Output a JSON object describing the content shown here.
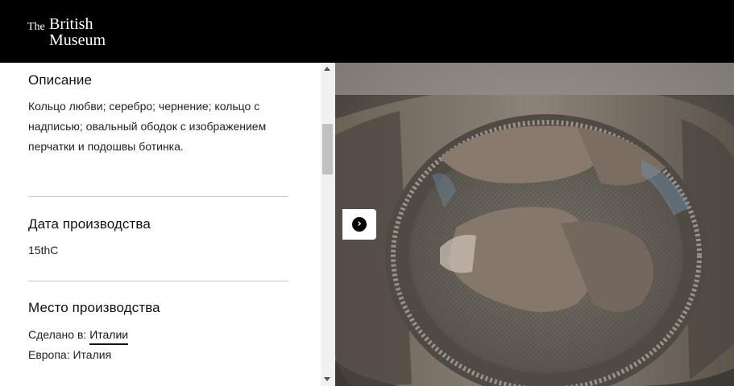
{
  "header": {
    "logo_the": "The",
    "logo_line1": "British",
    "logo_line2": "Museum"
  },
  "details": {
    "description": {
      "title": "Описание",
      "text": "Кольцо любви; серебро; чернение; кольцо с надписью; овальный ободок с изображением перчатки и подошвы ботинка."
    },
    "production_date": {
      "title": "Дата производства",
      "value": "15thC"
    },
    "production_place": {
      "title": "Место производства",
      "made_in_label": "Сделано в:",
      "made_in_link": "Италии",
      "region_line": "Европа: Италия"
    }
  },
  "viewer": {
    "next_icon": "chevron-right-icon",
    "image_subject": "silver finger ring with oval bezel"
  }
}
